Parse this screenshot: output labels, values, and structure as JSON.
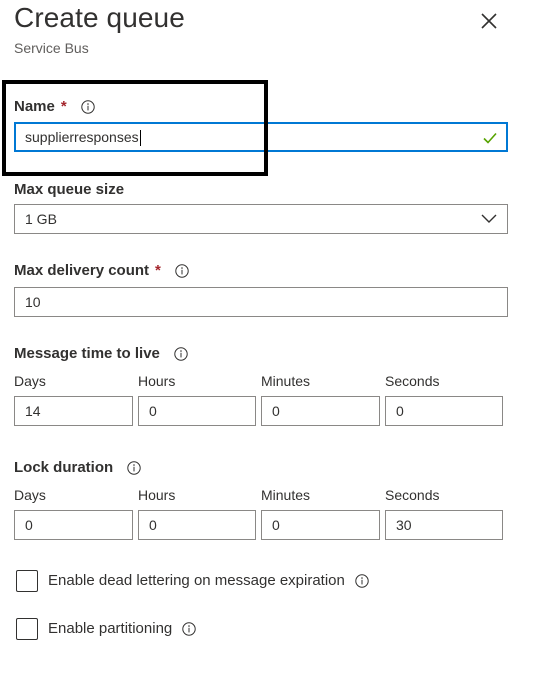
{
  "header": {
    "title": "Create queue",
    "subtitle": "Service Bus"
  },
  "name_field": {
    "label": "Name",
    "required_mark": "*",
    "value": "supplierresponses",
    "valid_icon": "checkmark-icon",
    "valid_color": "#57a300"
  },
  "max_queue_size": {
    "label": "Max queue size",
    "value": "1 GB"
  },
  "max_delivery_count": {
    "label": "Max delivery count",
    "required_mark": "*",
    "value": "10"
  },
  "message_ttl": {
    "label": "Message time to live",
    "units": {
      "days": "Days",
      "hours": "Hours",
      "minutes": "Minutes",
      "seconds": "Seconds"
    },
    "values": {
      "days": "14",
      "hours": "0",
      "minutes": "0",
      "seconds": "0"
    }
  },
  "lock_duration": {
    "label": "Lock duration",
    "units": {
      "days": "Days",
      "hours": "Hours",
      "minutes": "Minutes",
      "seconds": "Seconds"
    },
    "values": {
      "days": "0",
      "hours": "0",
      "minutes": "0",
      "seconds": "30"
    }
  },
  "options": {
    "dead_lettering": {
      "label": "Enable dead lettering on message expiration",
      "checked": false
    },
    "partitioning": {
      "label": "Enable partitioning",
      "checked": false
    }
  },
  "colors": {
    "accent": "#0078d4",
    "required": "#a4262c",
    "text": "#323130",
    "border": "#8a8886"
  }
}
